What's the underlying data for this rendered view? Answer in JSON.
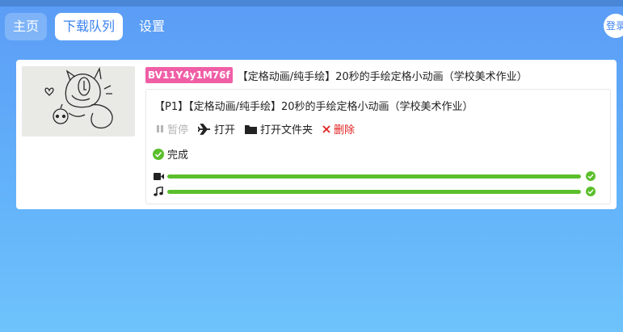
{
  "nav": {
    "tabs": [
      {
        "label": "主页"
      },
      {
        "label": "下载队列"
      },
      {
        "label": "设置"
      }
    ],
    "login_label": "登录"
  },
  "download": {
    "bvid": "BV11Y4y1M76f",
    "video_title": "【定格动画/纯手绘】20秒的手绘定格小动画（学校美术作业）",
    "part": {
      "title": "【P1】【定格动画/纯手绘】20秒的手绘定格小动画（学校美术作业）",
      "actions": {
        "pause": "暂停",
        "open": "打开",
        "open_folder": "打开文件夹",
        "delete": "删除"
      },
      "status": "完成",
      "video_progress": 1.0,
      "audio_progress": 1.0
    }
  },
  "colors": {
    "accent": "#3a82f0",
    "bvid_badge": "#f05fa6",
    "progress": "#5bbf2c",
    "danger": "#e02020"
  }
}
